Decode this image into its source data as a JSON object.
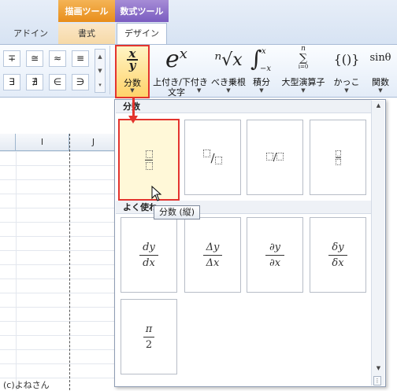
{
  "tabs": {
    "ctx_draw": "描画ツール",
    "ctx_equation": "数式ツール",
    "addin": "アドイン",
    "format": "書式",
    "design": "デザイン"
  },
  "symbols": {
    "row1": [
      "∓",
      "≅",
      "≈",
      "≡"
    ],
    "row2": [
      "∃",
      "∄",
      "∈",
      "∋"
    ]
  },
  "commands": {
    "fraction": "分数",
    "script": "上付き/下付き",
    "script_line2": "文字",
    "radical": "べき乗根",
    "integral": "積分",
    "large_operator": "大型演算子",
    "bracket": "かっこ",
    "function": "関数"
  },
  "command_icons": {
    "script": "e",
    "script_sup": "x",
    "radical": "ⁿ√x",
    "integral": "∫",
    "bracket": "{()}",
    "function": "sinθ"
  },
  "columns": [
    "I",
    "J"
  ],
  "panel": {
    "section_fraction": "分数",
    "section_common": "よく使わ",
    "slash_symbol": "/",
    "common": [
      {
        "num": "dy",
        "den": "dx"
      },
      {
        "num": "Δy",
        "den": "Δx"
      },
      {
        "num": "∂y",
        "den": "∂x"
      },
      {
        "num": "δy",
        "den": "δx"
      },
      {
        "num": "π",
        "den": "2"
      }
    ]
  },
  "tooltip": "分数 (縦)",
  "credit": "(c)よねさん",
  "colors": {
    "highlight": "#e3342e",
    "ctx_draw": "#e88d1a",
    "ctx_equation": "#7a5cc0"
  }
}
